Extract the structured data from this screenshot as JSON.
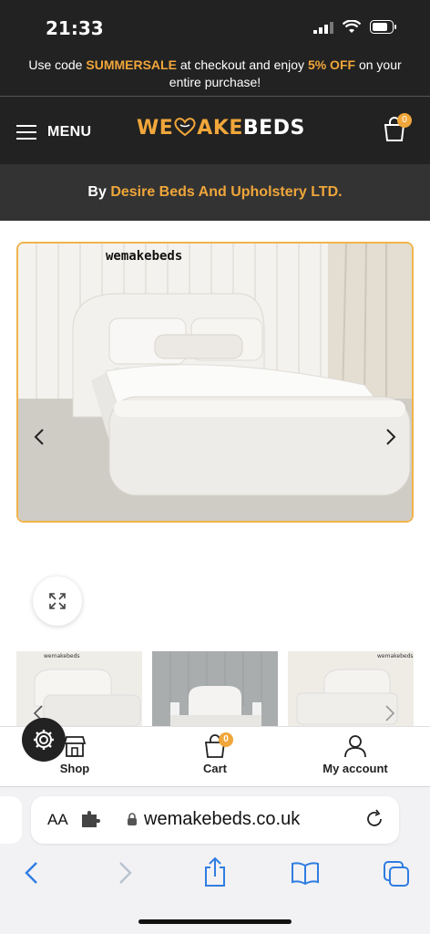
{
  "status_bar": {
    "time": "21:33"
  },
  "promo": {
    "prefix": "Use code ",
    "code": "SUMMERSALE",
    "middle": " at checkout and enjoy ",
    "discount": "5% OFF",
    "suffix": " on your entire purchase!"
  },
  "header": {
    "menu_label": "MENU",
    "logo_we": "WE",
    "logo_make": "AKE",
    "logo_beds": "BEDS",
    "cart_count": "0"
  },
  "vendor": {
    "prefix": "By ",
    "name": "Desire Beds And Upholstery LTD."
  },
  "product_image": {
    "brand_text": "wemakebeds"
  },
  "thumbnails": [
    {
      "brand": "wemakebeds"
    },
    {
      "brand": ""
    },
    {
      "brand": "wemakebeds"
    }
  ],
  "bottom_nav": {
    "shop_label": "Shop",
    "cart_label": "Cart",
    "cart_count": "0",
    "account_label": "My account"
  },
  "browser": {
    "aa_label": "AA",
    "url": "wemakebeds.co.uk"
  },
  "colors": {
    "accent": "#f0a63a",
    "dark": "#222222",
    "vendor_bg": "#333333"
  }
}
